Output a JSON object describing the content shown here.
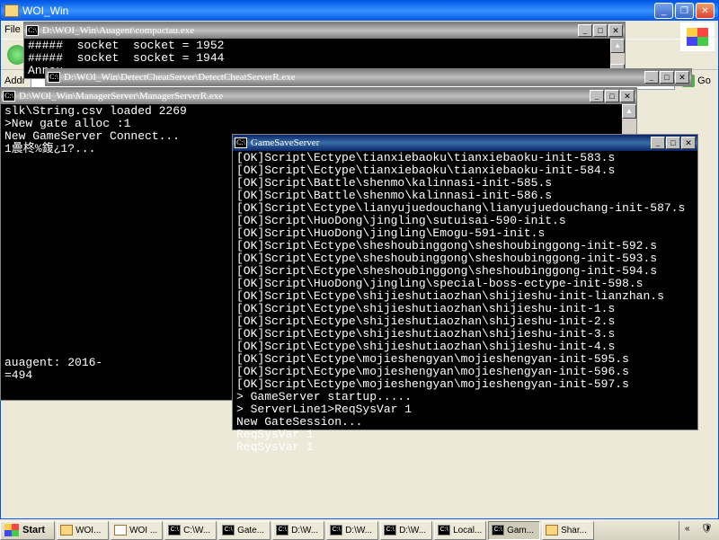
{
  "explorer": {
    "title": "WOI_Win",
    "menu_file": "File",
    "addr_label": "Addr",
    "go_label": "Go"
  },
  "con1": {
    "title": "D:\\WOI_Win\\Auagent\\compactau.exe",
    "lines": [
      "#####  socket  socket = 1952",
      "#####  socket  socket = 1944",
      "Annou"
    ]
  },
  "con2": {
    "title": "D:\\WOI_Win\\DetectCheatServer\\DetectCheatServerR.exe"
  },
  "con3": {
    "title": "D:\\WOI_Win\\ManagerServer\\ManagerServerR.exe",
    "lines": [
      "slk\\String.csv loaded 2269",
      ">New gate alloc :1",
      "New GameServer Connect...",
      "1曟柊%鍑¿1?...",
      "",
      "",
      "",
      "",
      "",
      "",
      "",
      "",
      "",
      "",
      "",
      "",
      "",
      "",
      "",
      "",
      "auagent: 2016-",
      "=494"
    ]
  },
  "con4": {
    "title": "GameSaveServer",
    "lines": [
      "[OK]Script\\Ectype\\tianxiebaoku\\tianxiebaoku-init-583.s",
      "[OK]Script\\Ectype\\tianxiebaoku\\tianxiebaoku-init-584.s",
      "[OK]Script\\Battle\\shenmo\\kalinnasi-init-585.s",
      "[OK]Script\\Battle\\shenmo\\kalinnasi-init-586.s",
      "[OK]Script\\Ectype\\lianyujuedouchang\\lianyujuedouchang-init-587.s",
      "[OK]Script\\HuoDong\\jingling\\sutuisai-590-init.s",
      "[OK]Script\\HuoDong\\jingling\\Emogu-591-init.s",
      "[OK]Script\\Ectype\\sheshoubinggong\\sheshoubinggong-init-592.s",
      "[OK]Script\\Ectype\\sheshoubinggong\\sheshoubinggong-init-593.s",
      "[OK]Script\\Ectype\\sheshoubinggong\\sheshoubinggong-init-594.s",
      "[OK]Script\\HuoDong\\jingling\\special-boss-ectype-init-598.s",
      "[OK]Script\\Ectype\\shijieshutiaozhan\\shijieshu-init-lianzhan.s",
      "[OK]Script\\Ectype\\shijieshutiaozhan\\shijieshu-init-1.s",
      "[OK]Script\\Ectype\\shijieshutiaozhan\\shijieshu-init-2.s",
      "[OK]Script\\Ectype\\shijieshutiaozhan\\shijieshu-init-3.s",
      "[OK]Script\\Ectype\\shijieshutiaozhan\\shijieshu-init-4.s",
      "[OK]Script\\Ectype\\mojieshengyan\\mojieshengyan-init-595.s",
      "[OK]Script\\Ectype\\mojieshengyan\\mojieshengyan-init-596.s",
      "[OK]Script\\Ectype\\mojieshengyan\\mojieshengyan-init-597.s",
      "> GameServer startup.....",
      "> ServerLine1>ReqSysVar 1",
      "New GateSession...",
      "ReqSysVar 1",
      "ReqSysVar 1"
    ]
  },
  "taskbar": {
    "start": "Start",
    "items": [
      {
        "label": "WOI...",
        "icon": "folder"
      },
      {
        "label": "WOI ...",
        "icon": "notepad"
      },
      {
        "label": "C:\\W...",
        "icon": "cmd"
      },
      {
        "label": "Gate...",
        "icon": "cmd"
      },
      {
        "label": "D:\\W...",
        "icon": "cmd"
      },
      {
        "label": "D:\\W...",
        "icon": "cmd"
      },
      {
        "label": "D:\\W...",
        "icon": "cmd"
      },
      {
        "label": "Local...",
        "icon": "cmd"
      },
      {
        "label": "Gam...",
        "icon": "cmd",
        "active": true
      },
      {
        "label": "Shar...",
        "icon": "folder"
      }
    ]
  }
}
